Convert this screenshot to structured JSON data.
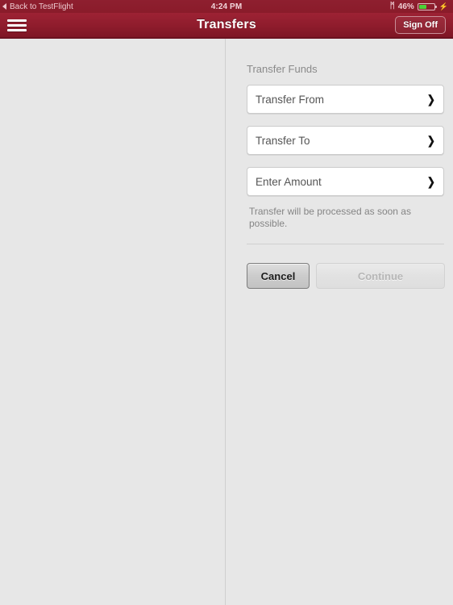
{
  "status_bar": {
    "back_label": "Back to TestFlight",
    "back_icon": "back-caret-icon",
    "clock": "4:24 PM",
    "bluetooth_icon": "bluetooth-icon",
    "bluetooth_glyph": "ᛗ",
    "battery_percent": "46%",
    "battery_level": 46,
    "charging_icon": "lightning-bolt-icon",
    "charging_glyph": "⚡",
    "battery_color": "#4cd137",
    "bar_color": "#8a1b2a"
  },
  "nav_bar": {
    "menu_icon": "hamburger-menu-icon",
    "title": "Transfers",
    "sign_off_label": "Sign Off",
    "brand_color": "#8e1c2c"
  },
  "main": {
    "section_title": "Transfer Funds",
    "rows": [
      {
        "label": "Transfer From",
        "chevron": "❯",
        "icon": "chevron-right-icon"
      },
      {
        "label": "Transfer To",
        "chevron": "❯",
        "icon": "chevron-right-icon"
      },
      {
        "label": "Enter Amount",
        "chevron": "❯",
        "icon": "chevron-right-icon"
      }
    ],
    "help_text": "Transfer will be processed as soon as possible.",
    "cancel_label": "Cancel",
    "continue_label": "Continue"
  }
}
